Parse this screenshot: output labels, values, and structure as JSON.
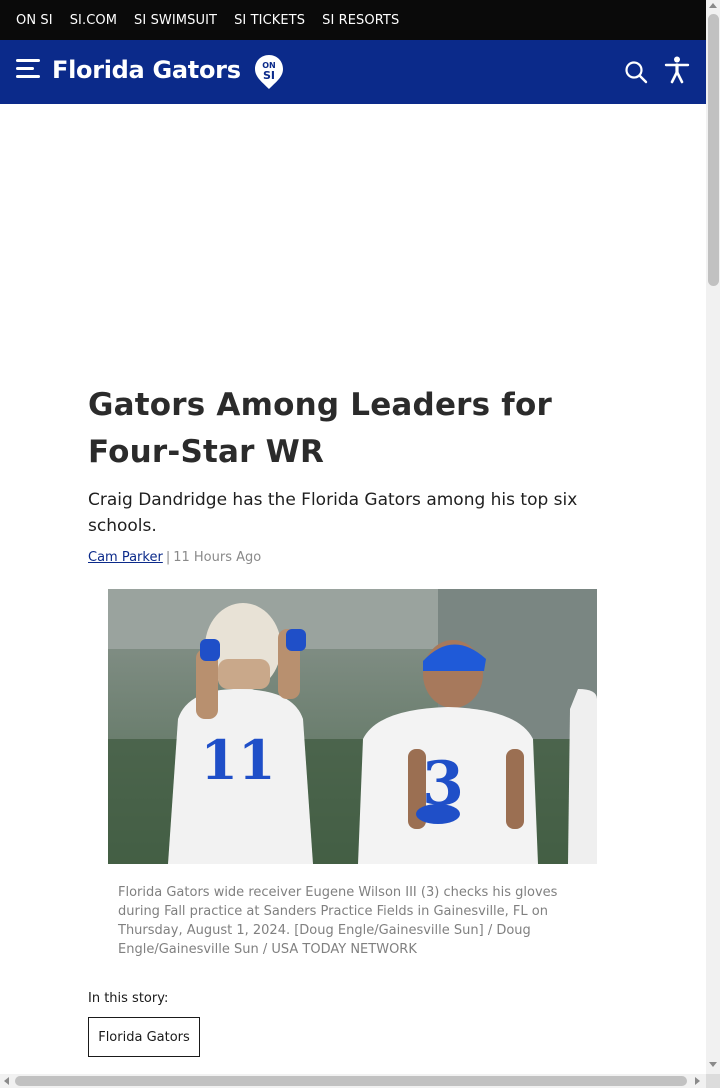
{
  "topnav": {
    "links": [
      "ON SI",
      "SI.COM",
      "SI SWIMSUIT",
      "SI TICKETS",
      "SI RESORTS"
    ]
  },
  "header": {
    "brand": "Florida Gators",
    "badge_text_top": "ON",
    "badge_text_bottom": "SI",
    "menu_icon": "hamburger-menu-icon",
    "search_icon": "search-icon",
    "accessibility_icon": "accessibility-icon"
  },
  "article": {
    "headline": "Gators Among Leaders for Four-Star WR",
    "subheadline": "Craig Dandridge has the Florida Gators among his top six schools.",
    "author": "Cam Parker",
    "separator": "|",
    "timestamp": "11 Hours Ago",
    "photo_caption": "Florida Gators wide receiver Eugene Wilson III (3) checks his gloves during Fall practice at Sanders Practice Fields in Gainesville, FL on Thursday, August 1, 2024. [Doug Engle/Gainesville Sun] / Doug Engle/Gainesville Sun / USA TODAY NETWORK",
    "story_label": "In this story:",
    "tags": [
      "Florida Gators"
    ]
  },
  "colors": {
    "topbar": "#0a0a0a",
    "navbar": "#0b2a8a",
    "link": "#0b2a8a",
    "jersey_numbers": "#1f4fc8"
  }
}
